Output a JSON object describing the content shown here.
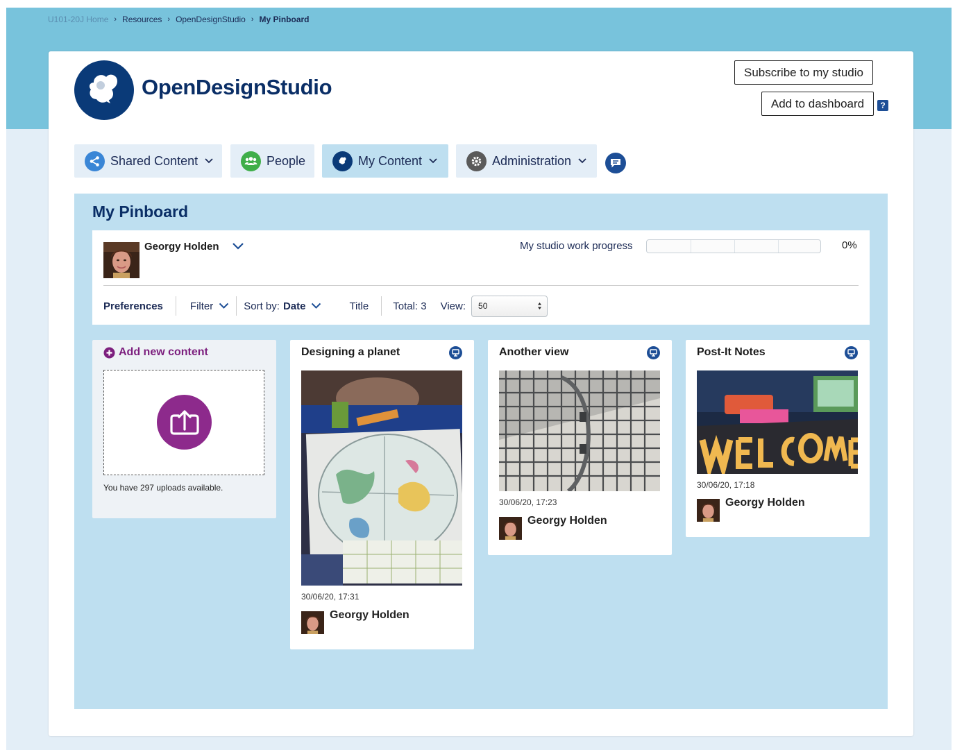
{
  "breadcrumb": {
    "items": [
      {
        "label": "U101-20J Home"
      },
      {
        "label": "Resources"
      },
      {
        "label": "OpenDesignStudio"
      },
      {
        "label": "My Pinboard"
      }
    ],
    "separator": "›"
  },
  "header": {
    "brand": "OpenDesignStudio",
    "subscribe_label": "Subscribe to my studio",
    "dashboard_label": "Add to dashboard",
    "help_label": "?"
  },
  "nav": {
    "shared_content": "Shared Content",
    "people": "People",
    "my_content": "My Content",
    "administration": "Administration"
  },
  "pinboard": {
    "title": "My Pinboard",
    "user_name": "Georgy Holden",
    "progress_label": "My studio work progress",
    "progress_percent": 0,
    "progress_text": "0%",
    "toolbar": {
      "preferences": "Preferences",
      "filter": "Filter",
      "sort_prefix": "Sort by:",
      "sort_value": "Date",
      "title": "Title",
      "total": "Total: 3",
      "view_label": "View:",
      "view_value": "50"
    }
  },
  "add_tile": {
    "title": "Add new content",
    "uploads_text": "You have 297 uploads available."
  },
  "tiles": [
    {
      "title": "Designing a planet",
      "date": "30/06/20, 17:31",
      "user": "Georgy Holden"
    },
    {
      "title": "Another view",
      "date": "30/06/20, 17:23",
      "user": "Georgy Holden"
    },
    {
      "title": "Post-It Notes",
      "date": "30/06/20, 17:18",
      "user": "Georgy Holden"
    }
  ],
  "colors": {
    "brand_navy": "#0a3a78",
    "top_band": "#78c3dc",
    "pinboard_bg": "#bedff0",
    "accent_purple": "#8d2a8c",
    "icon_blue": "#1d4e96",
    "people_green": "#3fae49"
  },
  "icons": {
    "logo": "opendesignstudio-logo",
    "shared": "share-icon",
    "people": "people-icon",
    "my_content": "my-content-icon",
    "admin": "gear-icon",
    "chat": "chat-icon",
    "upload": "upload-icon",
    "tile": "display-icon"
  }
}
